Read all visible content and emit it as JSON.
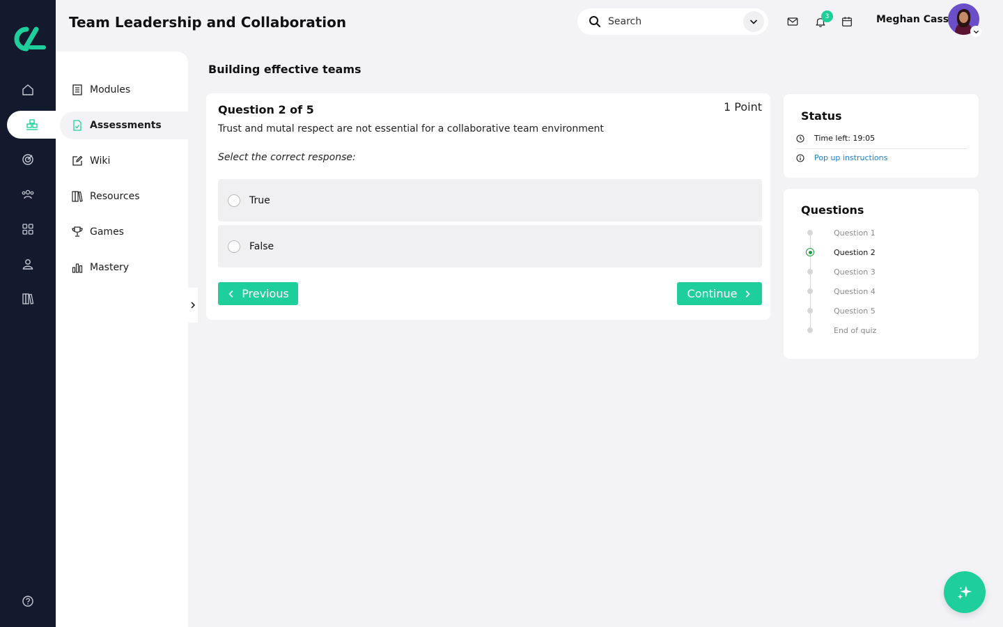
{
  "header": {
    "title": "Team Leadership and Collaboration",
    "search_placeholder": "Search",
    "notification_count": "3",
    "user_name": "Meghan Cass"
  },
  "rail": {
    "items": [
      "home-icon",
      "assessments-icon",
      "target-icon",
      "team-icon",
      "apps-icon",
      "profile-icon",
      "library-icon"
    ],
    "active": "assessments-icon",
    "footer": "help-icon"
  },
  "subnav": {
    "items": [
      {
        "label": "Modules",
        "icon": "modules-icon"
      },
      {
        "label": "Assessments",
        "icon": "assessment-doc-icon"
      },
      {
        "label": "Wiki",
        "icon": "edit-icon"
      },
      {
        "label": "Resources",
        "icon": "books-icon"
      },
      {
        "label": "Games",
        "icon": "trophy-icon"
      },
      {
        "label": "Mastery",
        "icon": "bar-chart-icon"
      }
    ],
    "active_index": 1
  },
  "main": {
    "section_title": "Building effective teams",
    "question": {
      "heading": "Question 2 of 5",
      "points": "1 Point",
      "text": "Trust and mutal respect are not essential for a collaborative team environment",
      "instruction": "Select the correct response:",
      "options": [
        "True",
        "False"
      ],
      "previous_label": "Previous",
      "continue_label": "Continue"
    }
  },
  "status": {
    "title": "Status",
    "time_left": "Time left: 19:05",
    "instructions_link": "Pop up instructions"
  },
  "questions_panel": {
    "title": "Questions",
    "items": [
      "Question 1",
      "Question 2",
      "Question 3",
      "Question 4",
      "Question 5",
      "End of quiz"
    ],
    "current_index": 1
  },
  "colors": {
    "accent": "#1fcf9b",
    "rail_bg": "#131a2e",
    "page_bg": "#f3f3f6",
    "link": "#1b7fd0",
    "current_step": "#1a9c3e"
  }
}
